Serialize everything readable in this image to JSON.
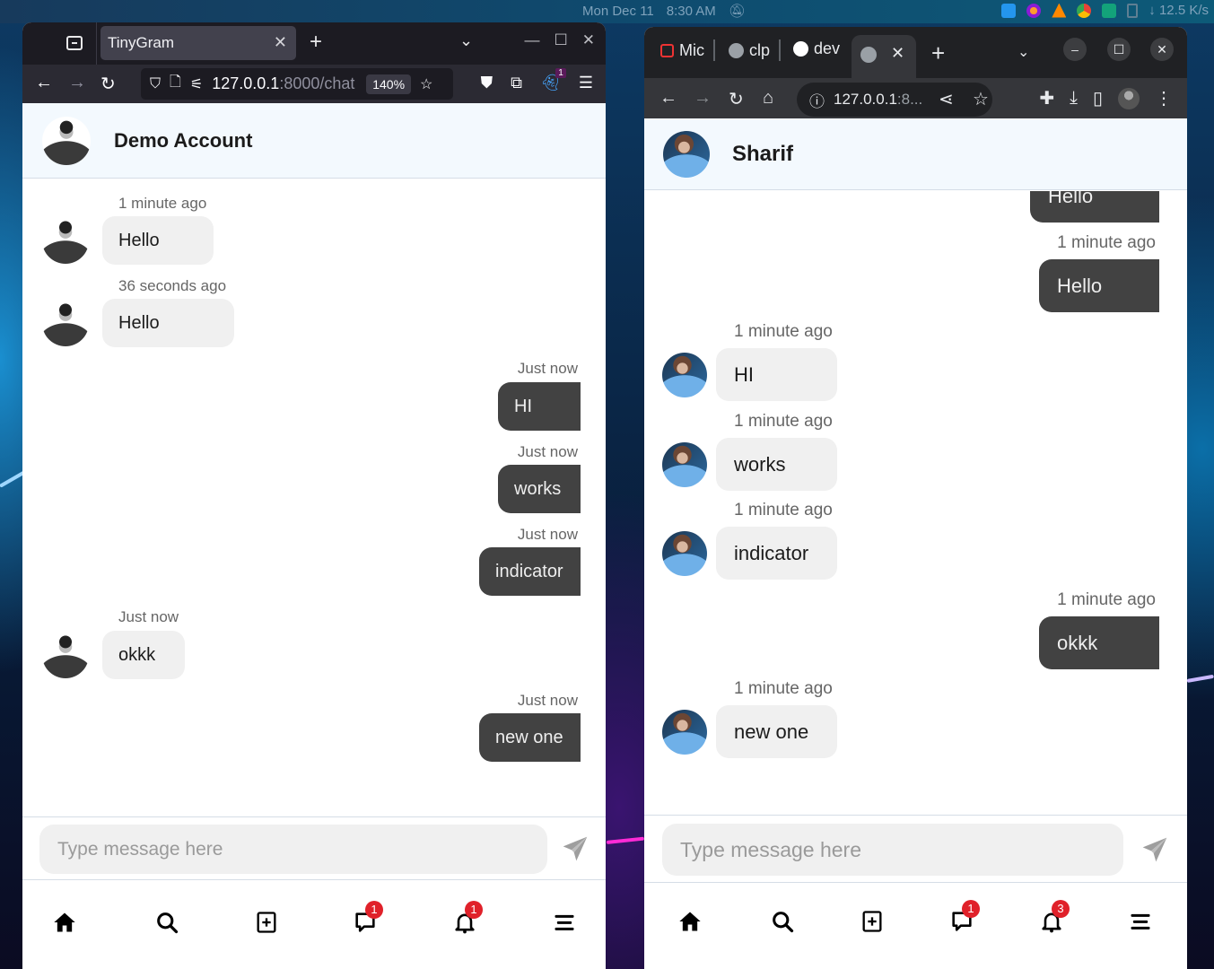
{
  "desktop": {
    "date": "Mon Dec 11",
    "time": "8:30 AM",
    "net_speed": "↓ 12.5 K/s",
    "tray_icons": [
      "docker-icon",
      "firefox-dev-icon",
      "vlc-icon",
      "chrome-icon",
      "app-icon",
      "clipboard-icon"
    ]
  },
  "firefox": {
    "tab_title": "TinyGram",
    "url_host": "127.0.0.1",
    "url_rest": ":8000/chat",
    "zoom": "140%",
    "extension_badge": "1",
    "chat": {
      "contact_name": "Demo Account",
      "composer_placeholder": "Type message here",
      "messages": [
        {
          "direction": "in",
          "time": "1 minute ago",
          "text": "Hello"
        },
        {
          "direction": "in",
          "time": "36 seconds ago",
          "text": "Hello"
        },
        {
          "direction": "out",
          "time": "Just now",
          "text": "HI"
        },
        {
          "direction": "out",
          "time": "Just now",
          "text": "works"
        },
        {
          "direction": "out",
          "time": "Just now",
          "text": "indicator"
        },
        {
          "direction": "in",
          "time": "Just now",
          "text": "okkk"
        },
        {
          "direction": "out",
          "time": "Just now",
          "text": "new one"
        }
      ],
      "nav": {
        "messages_badge": "1",
        "notifications_badge": "1"
      }
    }
  },
  "chrome": {
    "tabs": [
      {
        "title": "Mic",
        "icon": "laravel-icon"
      },
      {
        "title": "clp",
        "icon": "globe-icon"
      },
      {
        "title": "dev",
        "icon": "github-icon"
      }
    ],
    "url_host": "127.0.0.1",
    "url_rest": ":8...",
    "chat": {
      "contact_name": "Sharif",
      "composer_placeholder": "Type message here",
      "messages": [
        {
          "direction": "out",
          "time": "",
          "text": "Hello"
        },
        {
          "direction": "out",
          "time": "1 minute ago",
          "text": "Hello"
        },
        {
          "direction": "in",
          "time": "1 minute ago",
          "text": "HI"
        },
        {
          "direction": "in",
          "time": "1 minute ago",
          "text": "works"
        },
        {
          "direction": "in",
          "time": "1 minute ago",
          "text": "indicator"
        },
        {
          "direction": "out",
          "time": "1 minute ago",
          "text": "okkk"
        },
        {
          "direction": "in",
          "time": "1 minute ago",
          "text": "new one"
        }
      ],
      "nav": {
        "messages_badge": "1",
        "notifications_badge": "3"
      }
    }
  },
  "colors": {
    "incoming_bubble": "#f0f0f0",
    "outgoing_bubble": "#424242",
    "badge": "#e0212a",
    "header_bg": "#f3f9fe"
  }
}
